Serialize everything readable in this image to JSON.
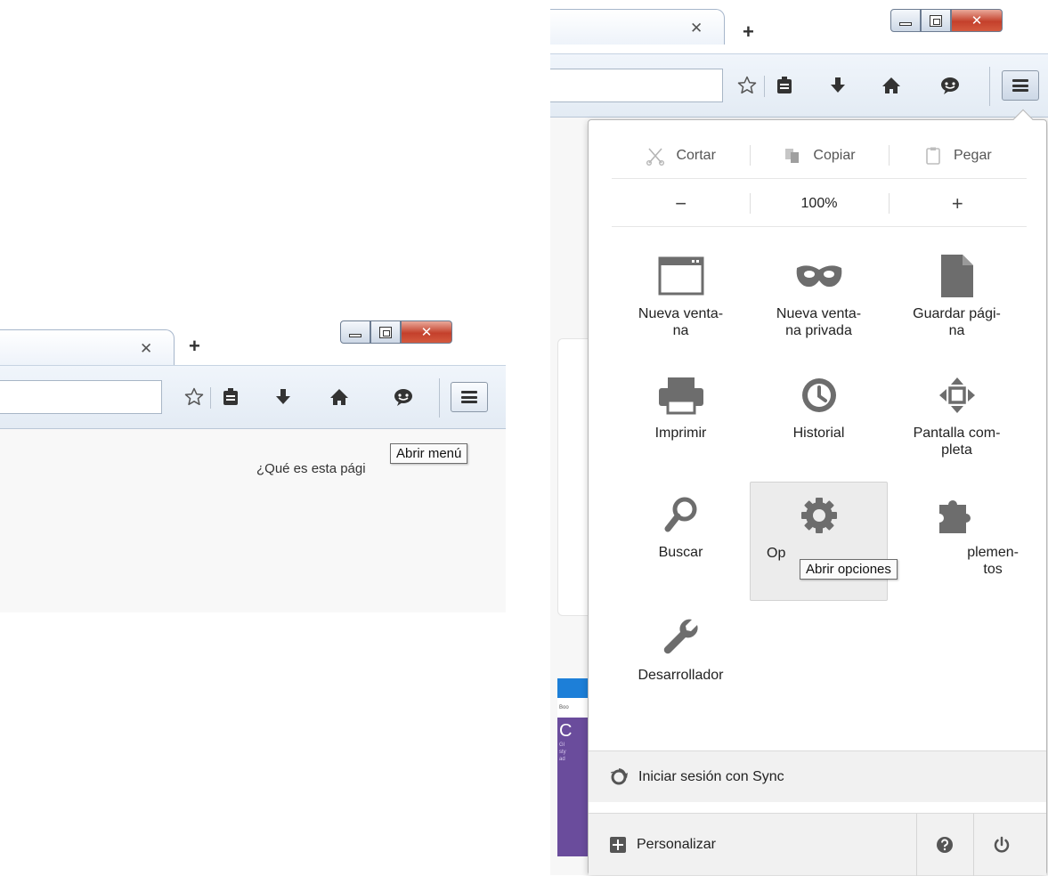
{
  "left_panel": {
    "page_text": "¿Qué es esta pági",
    "tooltip": "Abrir menú"
  },
  "right_panel": {
    "tooltip": "Abrir opciones"
  },
  "menu": {
    "edit": {
      "cut": "Cortar",
      "copy": "Copiar",
      "paste": "Pegar"
    },
    "zoom": {
      "minus": "−",
      "level": "100%",
      "plus": "+"
    },
    "items": [
      {
        "label": "Nueva venta-\nna",
        "icon": "window-icon"
      },
      {
        "label": "Nueva venta-\nna privada",
        "icon": "mask-icon"
      },
      {
        "label": "Guardar pági-\nna",
        "icon": "page-icon"
      },
      {
        "label": "Imprimir",
        "icon": "printer-icon"
      },
      {
        "label": "Historial",
        "icon": "clock-icon"
      },
      {
        "label": "Pantalla com-\npleta",
        "icon": "fullscreen-icon"
      },
      {
        "label": "Buscar",
        "icon": "search-icon"
      },
      {
        "label": "Op",
        "icon": "gear-icon"
      },
      {
        "label": "plemen-\ntos",
        "icon": "puzzle-icon"
      },
      {
        "label": "Desarrollador",
        "icon": "wrench-icon"
      }
    ],
    "sync": "Iniciar sesión con Sync",
    "customize": "Personalizar"
  },
  "thumbnail": {
    "big": "C",
    "small": "Gl\nsty\nad"
  }
}
